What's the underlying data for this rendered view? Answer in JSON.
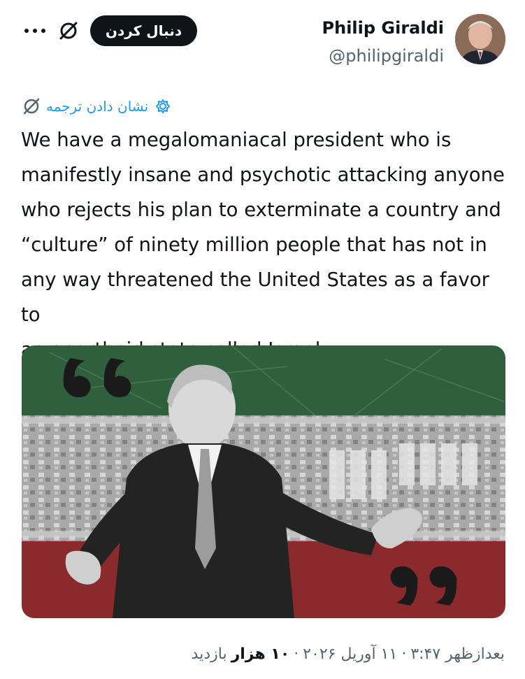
{
  "author": {
    "name": "Philip Giraldi",
    "handle": "@philipgiraldi"
  },
  "actions": {
    "follow_label": "دنبال کردن"
  },
  "translate": {
    "label": "نشان دادن ترجمه"
  },
  "tweet": {
    "lines": [
      "We have a megalomaniacal president who is",
      "manifestly insane and psychotic attacking anyone",
      "who rejects his plan to exterminate a country and",
      "“culture” of ninety million people that has not in",
      "any way threatened the United States as a favor to",
      "an apartheid state called Israel."
    ]
  },
  "footer": {
    "time": "بعدازظهر ۳:۴۷",
    "date": "۱۱ آوریل ۲۰۲۶",
    "views_count": "۱۰ هزار",
    "views_label": "بازدید",
    "separator": "·"
  },
  "colors": {
    "text": "#0f1419",
    "secondary": "#536471",
    "link": "#1d9bf0",
    "flag_green": "#2f5f3c",
    "flag_red": "#8a2a2c"
  },
  "icons": [
    "more-icon",
    "grok-icon",
    "translate-gear-icon",
    "slash-circle-icon"
  ]
}
